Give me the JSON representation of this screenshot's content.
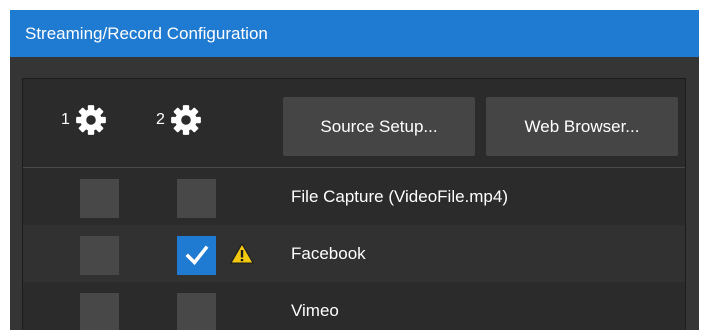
{
  "window": {
    "title": "Streaming/Record Configuration"
  },
  "header": {
    "channel_1": "1",
    "channel_2": "2",
    "source_setup_label": "Source Setup...",
    "web_browser_label": "Web Browser..."
  },
  "rows": [
    {
      "label": "File Capture (VideoFile.mp4)",
      "ch1": false,
      "ch2": false,
      "warning": false
    },
    {
      "label": "Facebook",
      "ch1": false,
      "ch2": true,
      "warning": true
    },
    {
      "label": "Vimeo",
      "ch1": false,
      "ch2": false,
      "warning": false
    }
  ],
  "colors": {
    "accent": "#1f7ad1",
    "warning": "#f2c811"
  },
  "icons": {
    "gear": "gear-icon",
    "check": "checkmark-icon",
    "warning": "warning-icon"
  }
}
